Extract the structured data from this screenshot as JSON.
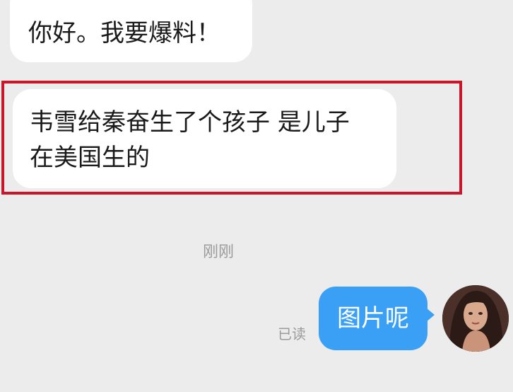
{
  "messages": {
    "incoming_1": "你好。我要爆料！",
    "incoming_2_line1": "韦雪给秦奋生了个孩子 是儿子",
    "incoming_2_line2": "在美国生的",
    "timestamp": "刚刚",
    "read_status": "已读",
    "outgoing_1": "图片呢"
  },
  "colors": {
    "background": "#ececec",
    "incoming_bubble": "#ffffff",
    "outgoing_bubble": "#3aa0f5",
    "highlight_border": "#c9162a"
  }
}
